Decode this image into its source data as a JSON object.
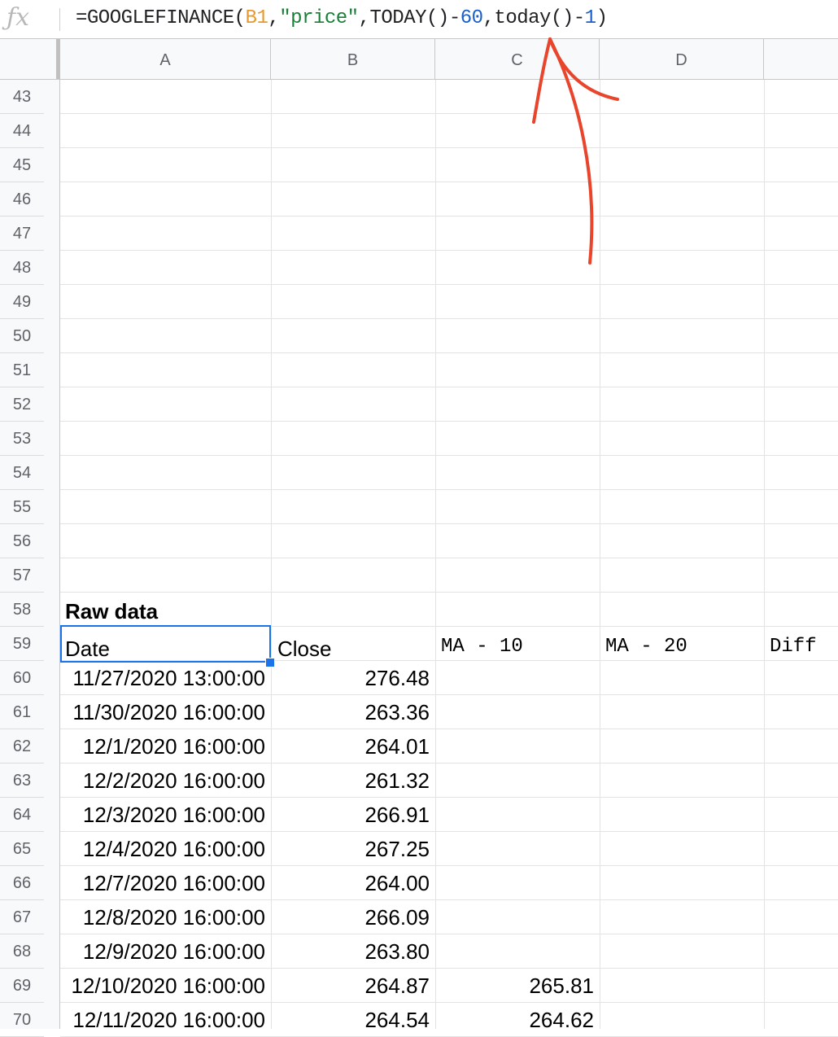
{
  "formula_bar": {
    "icon": "fx-icon",
    "formula_tokens": [
      {
        "text": "=GOOGLEFINANCE(",
        "kind": "plain"
      },
      {
        "text": "B1",
        "kind": "ref"
      },
      {
        "text": ",",
        "kind": "plain"
      },
      {
        "text": "\"price\"",
        "kind": "str"
      },
      {
        "text": ",TODAY()-",
        "kind": "plain"
      },
      {
        "text": "60",
        "kind": "num"
      },
      {
        "text": ",today()-",
        "kind": "plain"
      },
      {
        "text": "1",
        "kind": "num"
      },
      {
        "text": ")",
        "kind": "plain"
      }
    ]
  },
  "columns": [
    "A",
    "B",
    "C",
    "D"
  ],
  "row_numbers": [
    "43",
    "44",
    "45",
    "46",
    "47",
    "48",
    "49",
    "50",
    "51",
    "52",
    "53",
    "54",
    "55",
    "56",
    "57",
    "58",
    "59",
    "60",
    "61",
    "62",
    "63",
    "64",
    "65",
    "66",
    "67",
    "68",
    "69",
    "70"
  ],
  "section_label": "Raw data",
  "table_headers": {
    "date": "Date",
    "close": "Close",
    "ma10": "MA - 10",
    "ma20": "MA - 20",
    "diff": "Diff"
  },
  "rows": [
    {
      "date": "11/27/2020 13:00:00",
      "close": "276.48",
      "ma10": ""
    },
    {
      "date": "11/30/2020 16:00:00",
      "close": "263.36",
      "ma10": ""
    },
    {
      "date": "12/1/2020 16:00:00",
      "close": "264.01",
      "ma10": ""
    },
    {
      "date": "12/2/2020 16:00:00",
      "close": "261.32",
      "ma10": ""
    },
    {
      "date": "12/3/2020 16:00:00",
      "close": "266.91",
      "ma10": ""
    },
    {
      "date": "12/4/2020 16:00:00",
      "close": "267.25",
      "ma10": ""
    },
    {
      "date": "12/7/2020 16:00:00",
      "close": "264.00",
      "ma10": ""
    },
    {
      "date": "12/8/2020 16:00:00",
      "close": "266.09",
      "ma10": ""
    },
    {
      "date": "12/9/2020 16:00:00",
      "close": "263.80",
      "ma10": ""
    },
    {
      "date": "12/10/2020 16:00:00",
      "close": "264.87",
      "ma10": "265.81"
    },
    {
      "date": "12/11/2020 16:00:00",
      "close": "264.54",
      "ma10": "264.62"
    }
  ],
  "colors": {
    "selection": "#1a73e8",
    "annotation": "#e8452c",
    "ref": "#e69a2e",
    "string": "#188038",
    "number": "#1a5fc7"
  }
}
